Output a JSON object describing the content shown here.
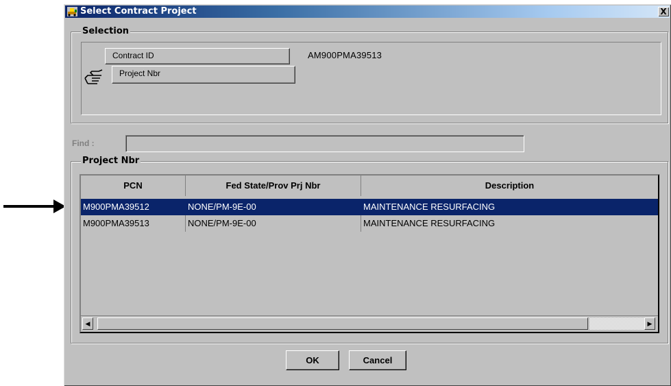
{
  "window": {
    "title": "Select Contract Project",
    "close_label": "X"
  },
  "selection": {
    "group_label": "Selection",
    "contract_id_label": "Contract ID",
    "contract_id_value": "AM900PMA39513",
    "project_nbr_label": "Project Nbr",
    "pointer_icon": "pointing-hand-icon"
  },
  "find": {
    "label": "Find :",
    "value": ""
  },
  "project_group": {
    "label": "Project Nbr",
    "columns": [
      "PCN",
      "Fed State/Prov Prj Nbr",
      "Description"
    ],
    "rows": [
      {
        "pcn": "M900PMA39512",
        "fed": "NONE/PM-9E-00",
        "desc": "MAINTENANCE RESURFACING",
        "selected": true
      },
      {
        "pcn": "M900PMA39513",
        "fed": "NONE/PM-9E-00",
        "desc": "MAINTENANCE RESURFACING",
        "selected": false
      }
    ]
  },
  "buttons": {
    "ok": "OK",
    "cancel": "Cancel"
  },
  "colors": {
    "selection_bg": "#0a246a",
    "window_bg": "#c0c0c0"
  }
}
